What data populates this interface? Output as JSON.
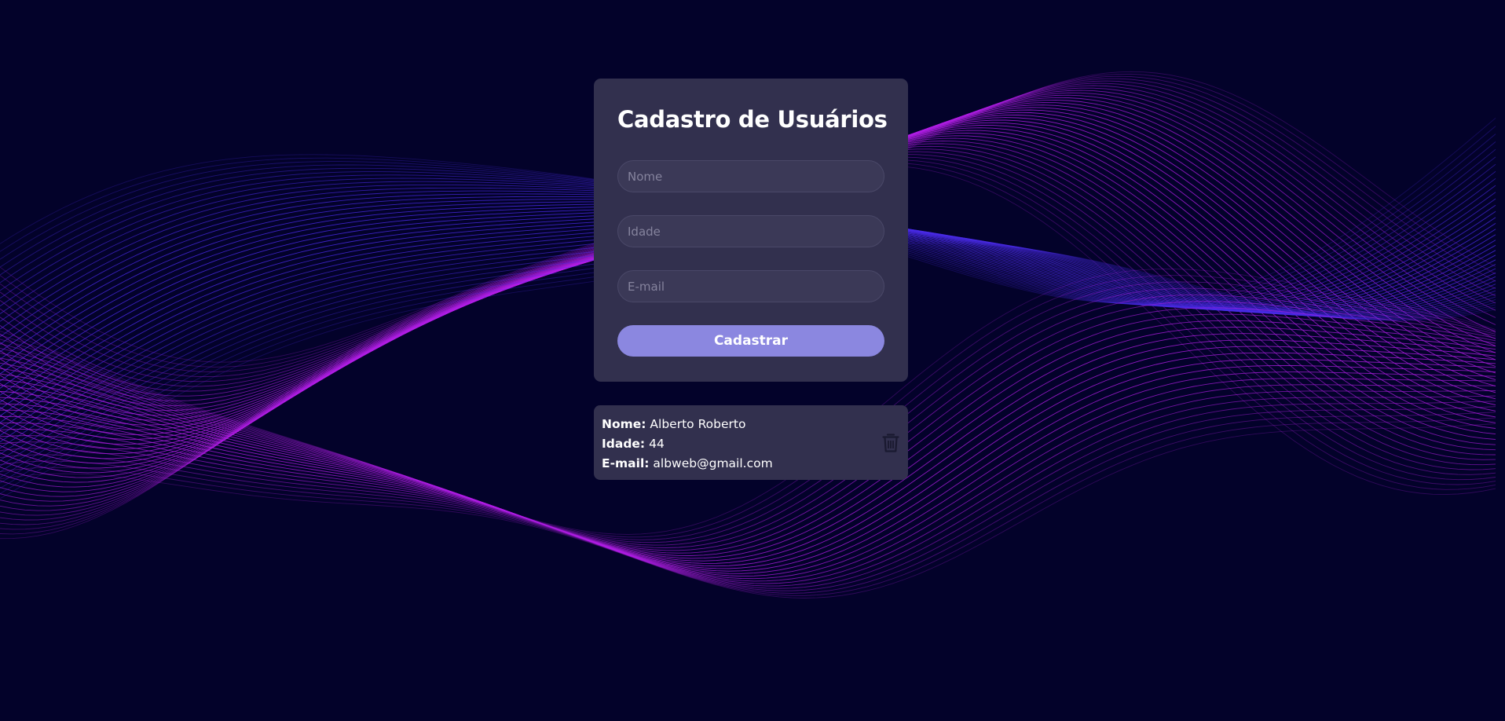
{
  "form": {
    "title": "Cadastro de Usuários",
    "name_placeholder": "Nome",
    "age_placeholder": "Idade",
    "email_placeholder": "E-mail",
    "submit_label": "Cadastrar"
  },
  "users": [
    {
      "name_label": "Nome:",
      "name": "Alberto Roberto",
      "age_label": "Idade:",
      "age": "44",
      "email_label": "E-mail:",
      "email": "albweb@gmail.com",
      "delete_icon": "trash-icon"
    }
  ],
  "colors": {
    "background": "#03022a",
    "card": "#32304e",
    "input": "#3b3957",
    "button": "#8b87e0",
    "wave_magenta": "#b21ee6",
    "wave_blue": "#4a2be8"
  }
}
